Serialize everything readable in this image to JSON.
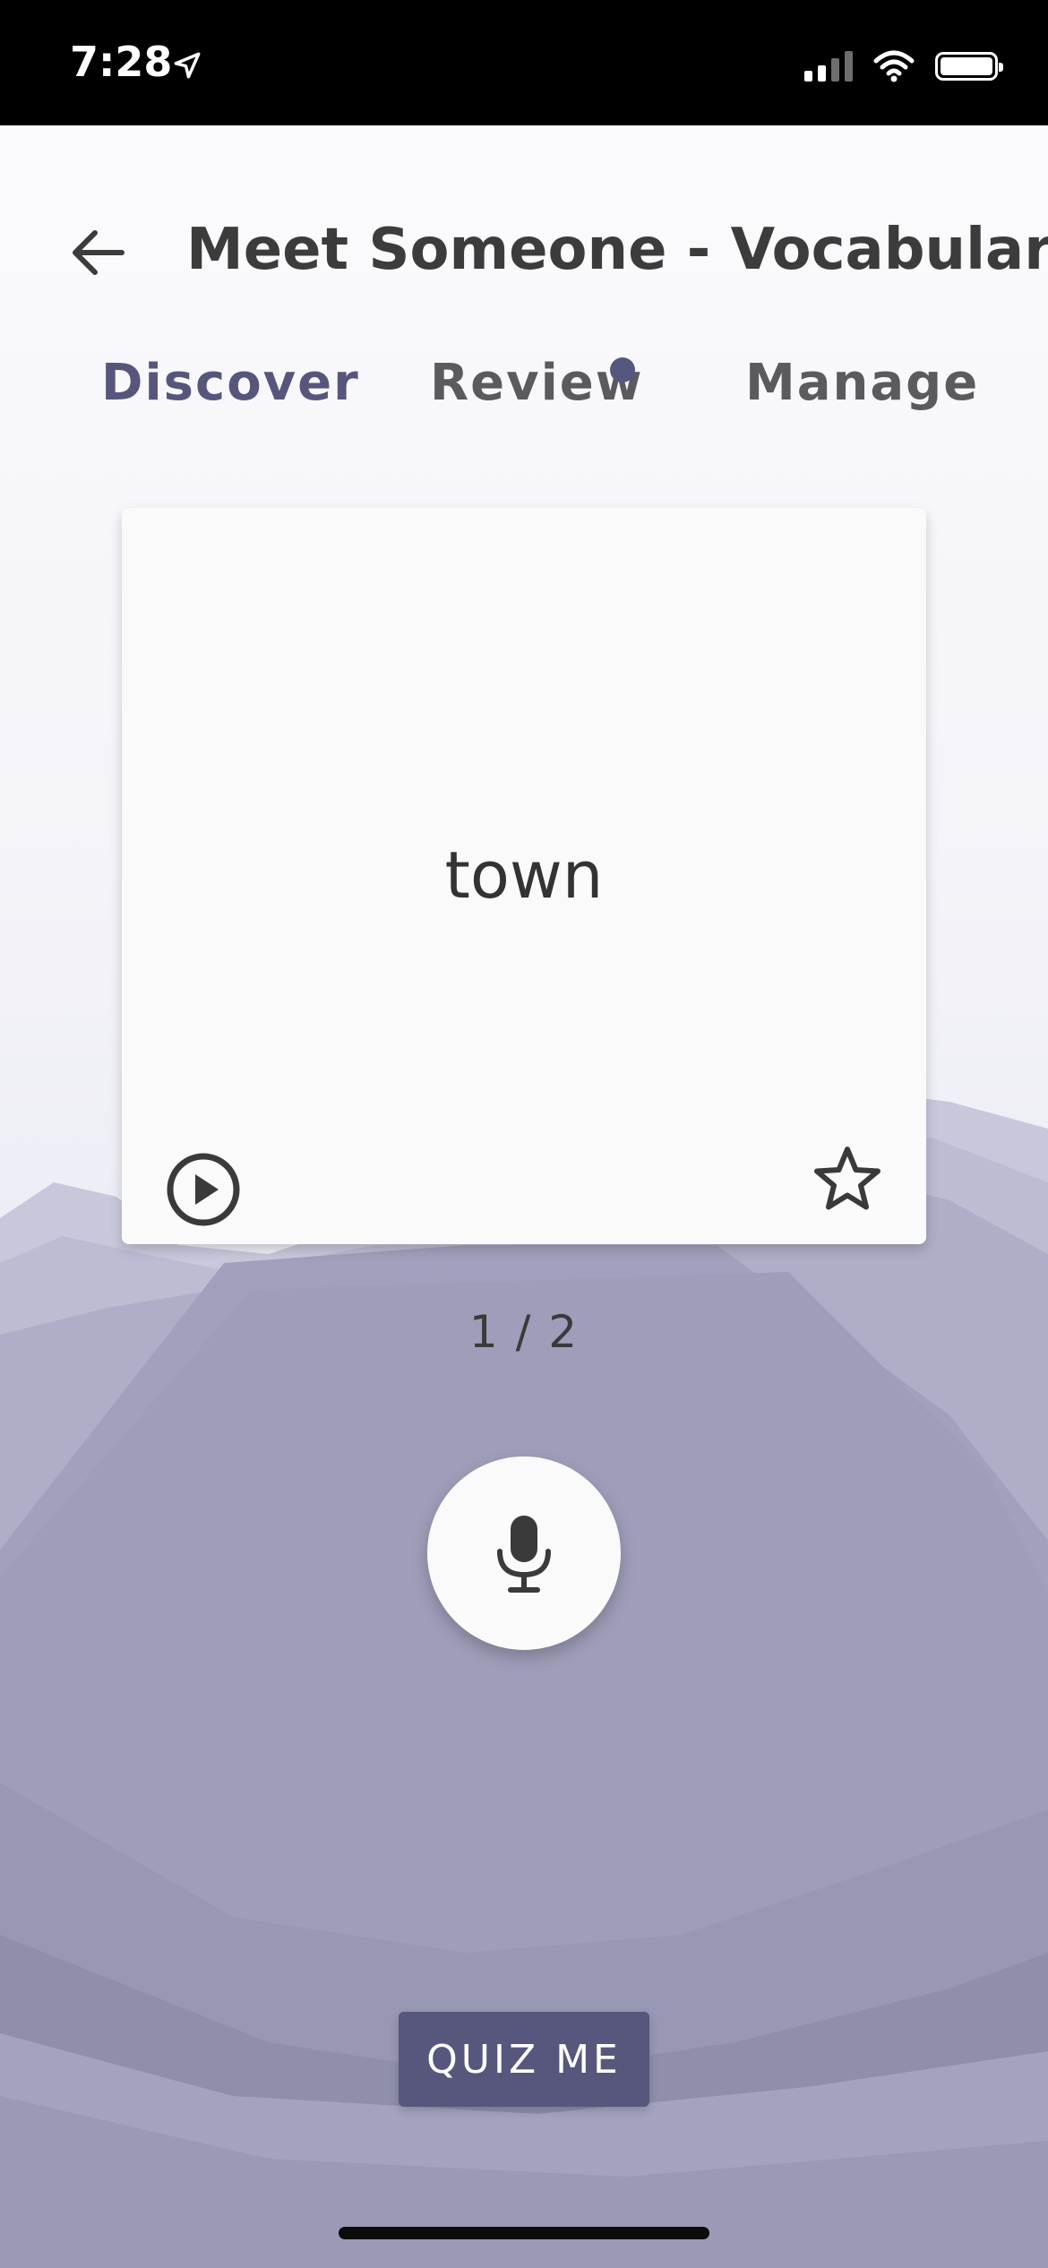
{
  "status_bar": {
    "time": "7:28",
    "icons": [
      "location-arrow-icon",
      "signal-icon",
      "wifi-icon",
      "battery-icon"
    ]
  },
  "header": {
    "title": "Meet Someone - Vocabulary",
    "back_icon": "arrow-left-icon"
  },
  "tabs": [
    {
      "label": "Discover",
      "active": true,
      "badge": false
    },
    {
      "label": "Review",
      "active": false,
      "badge": true
    },
    {
      "label": "Manage",
      "active": false,
      "badge": false
    }
  ],
  "card": {
    "word": "town",
    "play_icon": "play-circle-icon",
    "star_icon": "star-outline-icon"
  },
  "counter": "1 / 2",
  "mic_icon": "microphone-icon",
  "quiz_button": "QUIZ ME",
  "colors": {
    "accent": "#56577e",
    "status_bar": "#000000",
    "card_bg": "#fafafa",
    "text_dark": "#3c3c3c",
    "mountain_base": "#9f9fba"
  }
}
